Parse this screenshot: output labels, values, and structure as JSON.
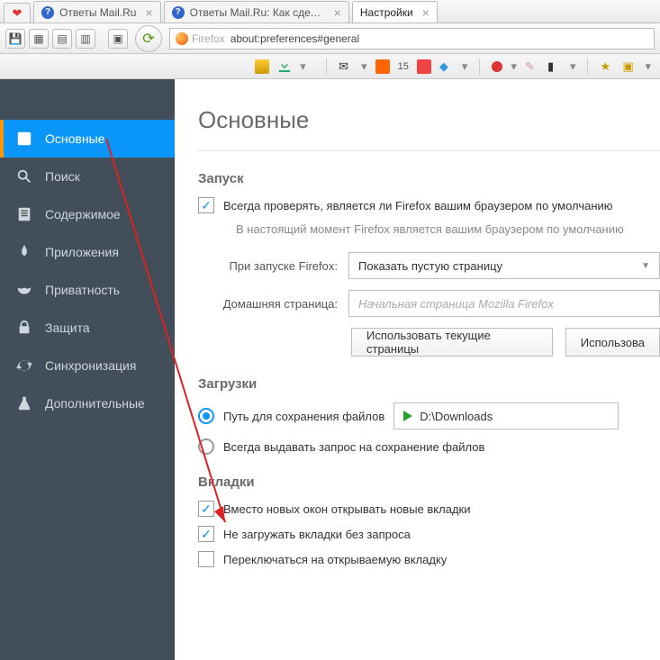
{
  "tabs": [
    {
      "label": "Ответы Mail.Ru"
    },
    {
      "label": "Ответы Mail.Ru: Как сдела…"
    },
    {
      "label": "Настройки"
    }
  ],
  "address": {
    "brand": "Firefox",
    "url": "about:preferences#general"
  },
  "toolbar2": {
    "badge": "15"
  },
  "sidebar": {
    "items": [
      {
        "label": "Основные"
      },
      {
        "label": "Поиск"
      },
      {
        "label": "Содержимое"
      },
      {
        "label": "Приложения"
      },
      {
        "label": "Приватность"
      },
      {
        "label": "Защита"
      },
      {
        "label": "Синхронизация"
      },
      {
        "label": "Дополнительные"
      }
    ]
  },
  "page": {
    "title": "Основные",
    "startup": {
      "heading": "Запуск",
      "check_default": "Всегда проверять, является ли Firefox вашим браузером по умолчанию",
      "is_default": "В настоящий момент Firefox является вашим браузером по умолчанию",
      "on_start_label": "При запуске Firefox:",
      "on_start_value": "Показать пустую страницу",
      "home_label": "Домашняя страница:",
      "home_placeholder": "Начальная страница Mozilla Firefox",
      "btn_current": "Использовать текущие страницы",
      "btn_bookmark": "Использова"
    },
    "downloads": {
      "heading": "Загрузки",
      "save_to": "Путь для сохранения файлов",
      "path": "D:\\Downloads",
      "always_ask": "Всегда выдавать запрос на сохранение файлов"
    },
    "tabs_section": {
      "heading": "Вкладки",
      "c1": "Вместо новых окон открывать новые вкладки",
      "c2": "Не загружать вкладки без запроса",
      "c3": "Переключаться на открываемую вкладку"
    }
  }
}
